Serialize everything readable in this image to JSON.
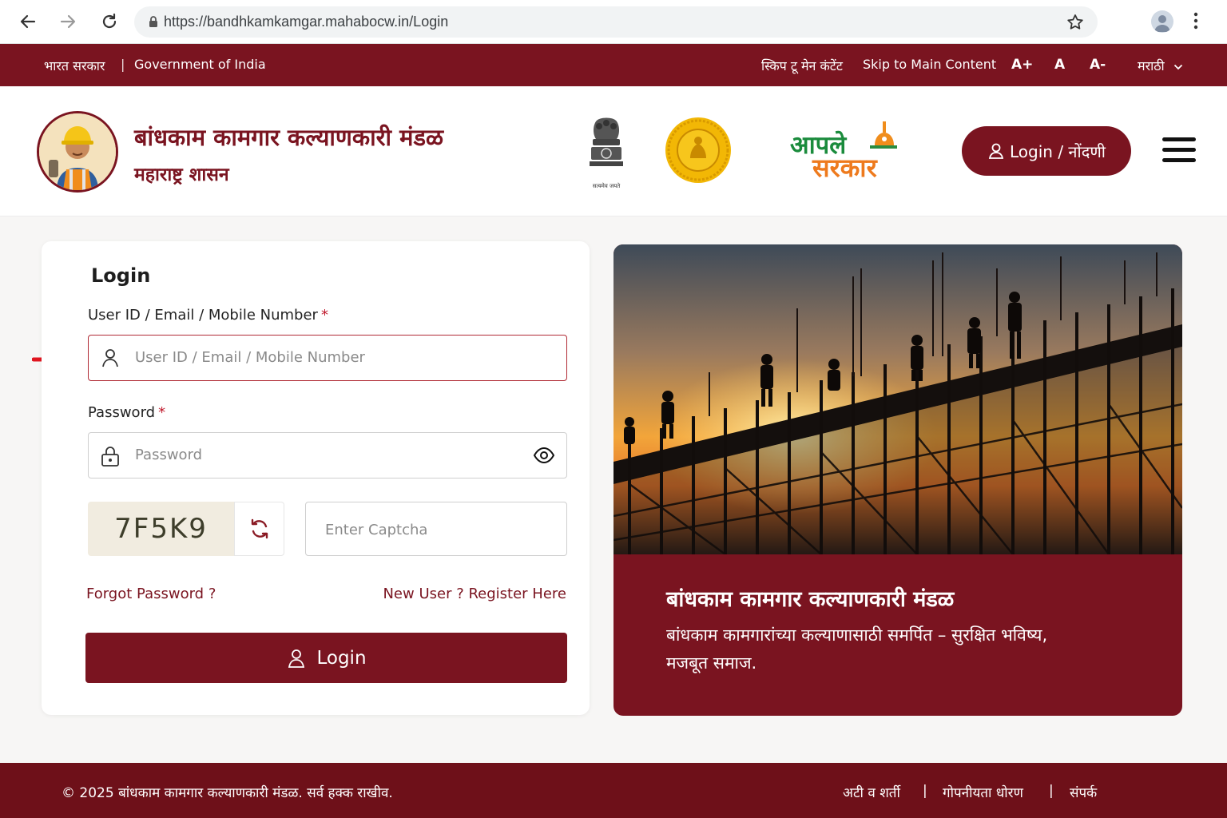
{
  "browser": {
    "url": "https://bandhkamkamgar.mahabocw.in/Login"
  },
  "govbar": {
    "gov_hindi": "भारत सरकार",
    "separator": "|",
    "gov_english": "Government of India",
    "skip_marathi": "स्किप टू मेन कंटेंट",
    "skip_english": "Skip to Main Content",
    "font_increase": "A+",
    "font_normal": "A",
    "font_decrease": "A-",
    "language": "मराठी"
  },
  "header": {
    "title": "बांधकाम कामगार कल्याणकारी मंडळ",
    "subtitle": "महाराष्ट्र शासन",
    "emblem_motto": "सत्यमेव जयते",
    "aaple_line1": "आपले",
    "aaple_line2": "सरकार",
    "login_button": "Login / नोंदणी"
  },
  "login_form": {
    "title": "Login",
    "user_label": "User ID / Email / Mobile Number",
    "user_placeholder": "User ID / Email / Mobile Number",
    "required_mark": "*",
    "password_label": "Password",
    "password_placeholder": "Password",
    "captcha_code": "7F5K9",
    "captcha_placeholder": "Enter Captcha",
    "forgot_link": "Forgot Password ?",
    "register_link": "New User ? Register Here",
    "submit_label": "Login"
  },
  "hero": {
    "title": "बांधकाम कामगार कल्याणकारी मंडळ",
    "description": "बांधकाम कामगारांच्या कल्याणासाठी समर्पित – सुरक्षित भविष्य, मजबूत समाज."
  },
  "footer": {
    "copyright": "© 2025 बांधकाम कामगार कल्याणकारी मंडळ. सर्व हक्क राखीव.",
    "terms": "अटी व शर्ती",
    "separator": "|",
    "privacy": "गोपनीयता धोरण",
    "contact": "संपर्क"
  },
  "colors": {
    "brand": "#7a1420",
    "footer": "#6e1019",
    "highlight_arrow": "#e0151f"
  }
}
